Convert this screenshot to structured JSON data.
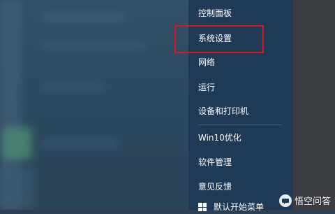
{
  "menu": {
    "items": [
      {
        "label": "控制面板"
      },
      {
        "label": "系统设置"
      },
      {
        "label": "网络"
      },
      {
        "label": "运行"
      },
      {
        "label": "设备和打印机"
      },
      {
        "label": "Win10优化"
      },
      {
        "label": "软件管理"
      },
      {
        "label": "意见反馈"
      }
    ],
    "partial_item": "默认开始菜单"
  },
  "watermark": {
    "text": "悟空问答"
  },
  "colors": {
    "menu_bg": "#1f3a57",
    "highlight": "#d71920",
    "text": "#ffffff"
  }
}
